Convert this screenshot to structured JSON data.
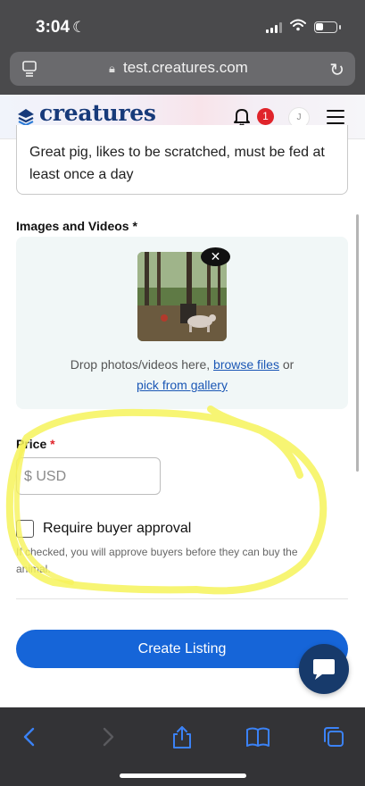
{
  "status_bar": {
    "time": "3:04"
  },
  "browser": {
    "url": "test.creatures.com"
  },
  "header": {
    "logo_text": "creatures",
    "notification_count": "1",
    "avatar_initial": "J"
  },
  "form": {
    "description_value": "Great pig, likes to be scratched, must be fed at least once a day",
    "images_label": "Images and Videos",
    "images_required_marker": "*",
    "drop_text": "Drop photos/videos here,",
    "browse_link": "browse files",
    "or_text": "or",
    "gallery_link": "pick from gallery",
    "price_label": "Price",
    "price_required_marker": "*",
    "price_placeholder": "$ USD",
    "approval_label": "Require buyer approval",
    "approval_help": "If checked, you will approve buyers before they can buy the animal.",
    "submit_label": "Create Listing",
    "thumbnail_remove_glyph": "✕"
  },
  "colors": {
    "primary": "#1665d8",
    "brand": "#173a7a",
    "highlight": "#f6f35a",
    "required": "#e0242b"
  },
  "icons": [
    "moon-icon",
    "signal-icon",
    "wifi-icon",
    "battery-icon",
    "reader-icon",
    "lock-icon",
    "reload-icon",
    "logo-icon",
    "bell-icon",
    "menu-icon",
    "close-icon",
    "chat-icon",
    "back-icon",
    "forward-icon",
    "share-icon",
    "bookmarks-icon",
    "tabs-icon"
  ]
}
